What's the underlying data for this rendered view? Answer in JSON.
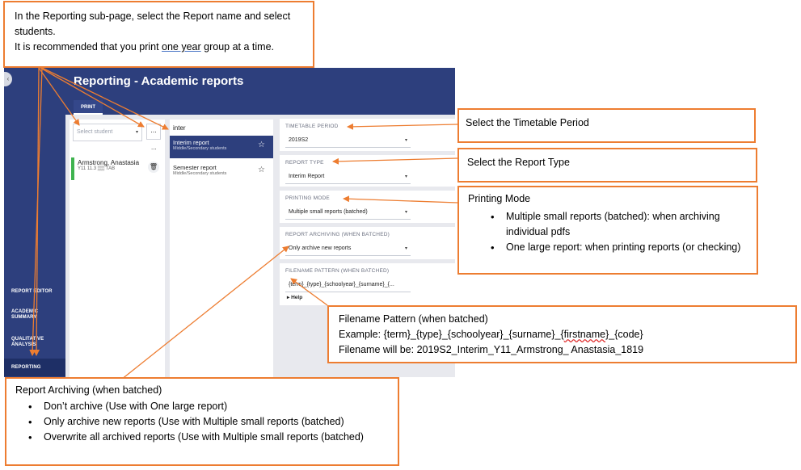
{
  "app": {
    "page_title": "Reporting - Academic reports",
    "tab_print": "PRINT",
    "collapse_icon": "‹",
    "sidebar": {
      "report_editor": "REPORT EDITOR",
      "academic_summary": "ACADEMIC SUMMARY",
      "qualitative_analysis": "QUALITATIVE ANALYSIS",
      "reporting": "REPORTING"
    },
    "students": {
      "search_placeholder": "Select student",
      "more_label": "...",
      "dots_label": "...",
      "rows": [
        {
          "name": "Armstrong, Anastasia",
          "meta": "Y11 11.3 ▒▒ TAB",
          "delete_icon": "🗑"
        }
      ]
    },
    "reports": {
      "search_value": "inter",
      "items": [
        {
          "name": "Interim report",
          "sub": "Middle/Secondary students",
          "star": "☆"
        },
        {
          "name": "Semester report",
          "sub": "Middle/Secondary students",
          "star": "☆"
        }
      ]
    },
    "settings": {
      "timetable_period": {
        "label": "TIMETABLE PERIOD",
        "value": "2019S2"
      },
      "report_type": {
        "label": "REPORT TYPE",
        "value": "Interim Report"
      },
      "printing_mode": {
        "label": "PRINTING MODE",
        "value": "Multiple small reports (batched)"
      },
      "report_archiving": {
        "label": "REPORT ARCHIVING (WHEN BATCHED)",
        "value": "Only archive new reports"
      },
      "filename_pattern": {
        "label": "FILENAME PATTERN (WHEN BATCHED)",
        "value": "{term}_{type}_{schoolyear}_{surname}_{..."
      },
      "help_label": "Help"
    }
  },
  "callouts": {
    "top": {
      "line1": "In the Reporting sub-page, select the Report name and select students.",
      "line2_before": "It is recommended that you print ",
      "line2_underlined": "one year",
      "line2_after": " group at a time."
    },
    "timetable": "Select the Timetable Period",
    "report_type": "Select the Report Type",
    "printing_mode": {
      "title": "Printing Mode",
      "bullets": [
        "Multiple small reports (batched): when archiving individual pdfs",
        "One large report: when printing reports (or checking)"
      ]
    },
    "filename": {
      "title": "Filename Pattern (when batched)",
      "example_before": "Example: {term}_{type}_{schoolyear}_{surname}_{",
      "example_wavy": "firstname",
      "example_after": "}_{code}",
      "result": "Filename will be: 2019S2_Interim_Y11_Armstrong_ Anastasia_1819"
    },
    "archiving": {
      "title": "Report Archiving (when batched)",
      "bullets": [
        "Don’t archive (Use with One large report)",
        "Only archive new reports (Use with Multiple small reports (batched)",
        "Overwrite all archived reports (Use with Multiple small reports (batched)"
      ]
    }
  },
  "colors": {
    "callout_border": "#ed7d31",
    "nav_blue": "#2d3f7d",
    "selected_green": "#3fb34f"
  }
}
